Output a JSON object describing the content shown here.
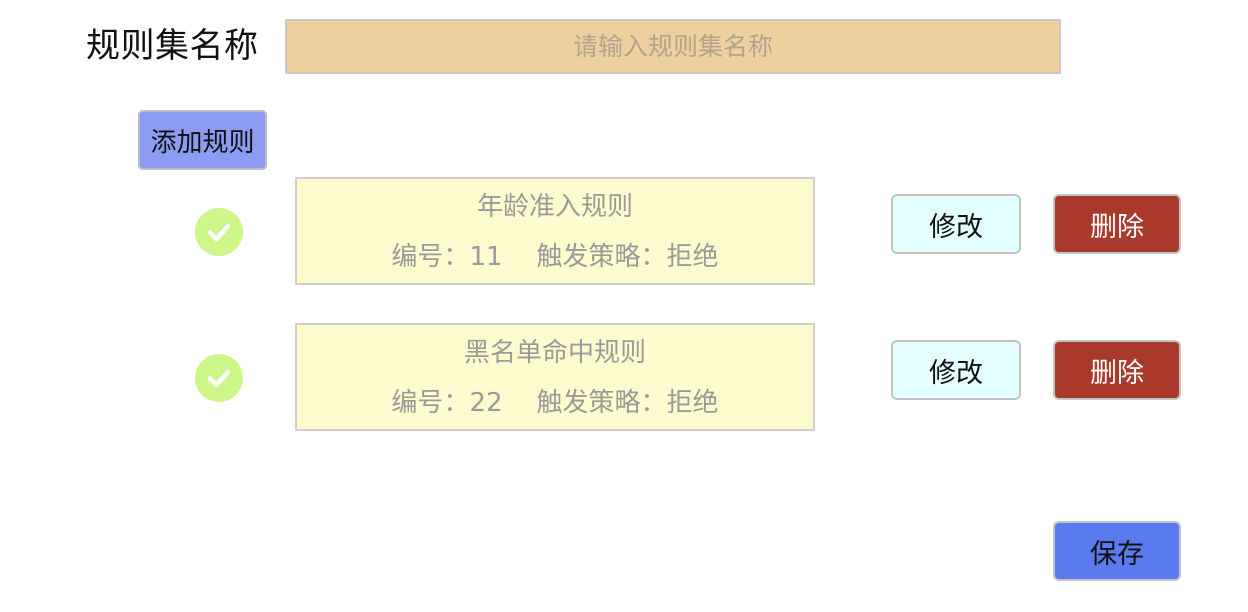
{
  "ruleset": {
    "name_label": "规则集名称",
    "name_value": "",
    "name_placeholder": "请输入规则集名称"
  },
  "toolbar": {
    "add_rule_label": "添加规则"
  },
  "rules": [
    {
      "name": "年龄准入规则",
      "id_label": "编号：",
      "id_value": "11",
      "strategy_label": "触发策略：",
      "strategy_value": "拒绝",
      "enabled": true,
      "edit_label": "修改",
      "delete_label": "删除"
    },
    {
      "name": "黑名单命中规则",
      "id_label": "编号：",
      "id_value": "22",
      "strategy_label": "触发策略：",
      "strategy_value": "拒绝",
      "enabled": true,
      "edit_label": "修改",
      "delete_label": "删除"
    }
  ],
  "footer": {
    "save_label": "保存"
  },
  "icons": {
    "status": "check-circle-icon"
  },
  "colors": {
    "input_background": "#eecf9f",
    "add_button": "#8c9cf2",
    "rule_card": "#fefccf",
    "check": "#ccf58a",
    "edit_button": "#e4ffff",
    "delete_button": "#a9392b",
    "save_button": "#5a7af0"
  }
}
